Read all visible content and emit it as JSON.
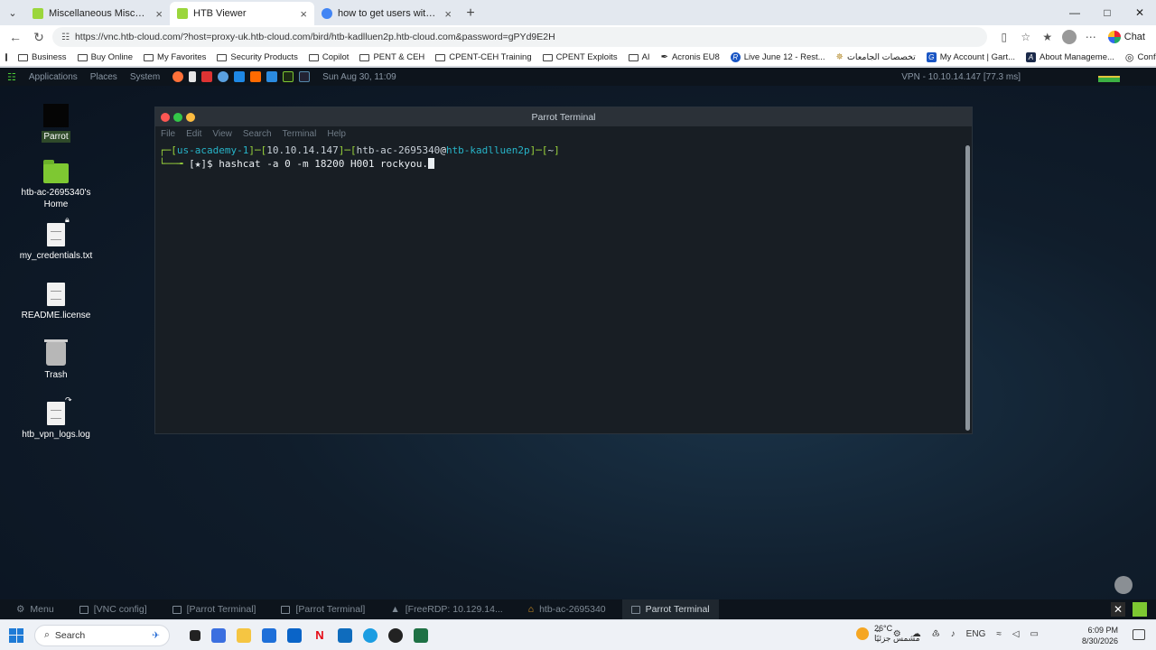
{
  "browser": {
    "tabs": [
      {
        "title": "Miscellaneous Misconfigurations |",
        "active": false,
        "color": "#9bd63c"
      },
      {
        "title": "HTB Viewer",
        "active": true,
        "color": "#9bd63c"
      },
      {
        "title": "how to get users with passwd_not",
        "active": false,
        "color": "#4285f4"
      }
    ],
    "url": "https://vnc.htb-cloud.com/?host=proxy-uk.htb-cloud.com/bird/htb-kadlluen2p.htb-cloud.com&password=gPYd9E2H",
    "chat_label": "Chat",
    "bookmarks": [
      "Business",
      "Buy Online",
      "My Favorites",
      "Security Products",
      "Copilot",
      "PENT & CEH",
      "CPENT-CEH Training",
      "CPENT Exploits",
      "AI",
      "Acronis EU8",
      "Live June 12 - Rest...",
      "تخصصات الجامعات",
      "My Account | Gart...",
      "About Manageme...",
      "Configuring your..."
    ]
  },
  "remote": {
    "panel": {
      "applications": "Applications",
      "places": "Places",
      "system": "System",
      "datetime": "Sun Aug 30, 11:09",
      "vpn": "VPN - 10.10.14.147 [77.3 ms]"
    },
    "desktop_icons": [
      {
        "label": "Parrot"
      },
      {
        "label": "htb-ac-2695340's Home"
      },
      {
        "label": "my_credentials.txt"
      },
      {
        "label": "README.license"
      },
      {
        "label": "Trash"
      },
      {
        "label": "htb_vpn_logs.log"
      }
    ],
    "terminal": {
      "title": "Parrot Terminal",
      "menu": [
        "File",
        "Edit",
        "View",
        "Search",
        "Terminal",
        "Help"
      ],
      "prompt_line1": {
        "bracket_open": "┌─[",
        "session": "us-academy-1",
        "mid1": "]─[",
        "ip": "10.10.14.147",
        "mid2": "]─[",
        "user": "htb-ac-2695340",
        "at": "@",
        "host": "htb-kadlluen2p",
        "mid3": "]─[",
        "dir": "~",
        "bracket_close": "]"
      },
      "prompt_line2": {
        "prefix": "└──╼ ",
        "marker": "[★]$ ",
        "command": "hashcat -a 0 -m 18200 H001 rockyou."
      }
    },
    "bottom_panel": {
      "menu": "Menu",
      "items": [
        "[VNC config]",
        "[Parrot Terminal]",
        "[Parrot Terminal]",
        "[FreeRDP: 10.129.14...",
        "htb-ac-2695340",
        "Parrot Terminal"
      ]
    }
  },
  "taskbar": {
    "search": "Search",
    "weather_temp": "26°C",
    "weather_desc": "مشمس جزئيًا",
    "lang": "ENG",
    "time": "6:09 PM",
    "date": "8/30/2026"
  }
}
